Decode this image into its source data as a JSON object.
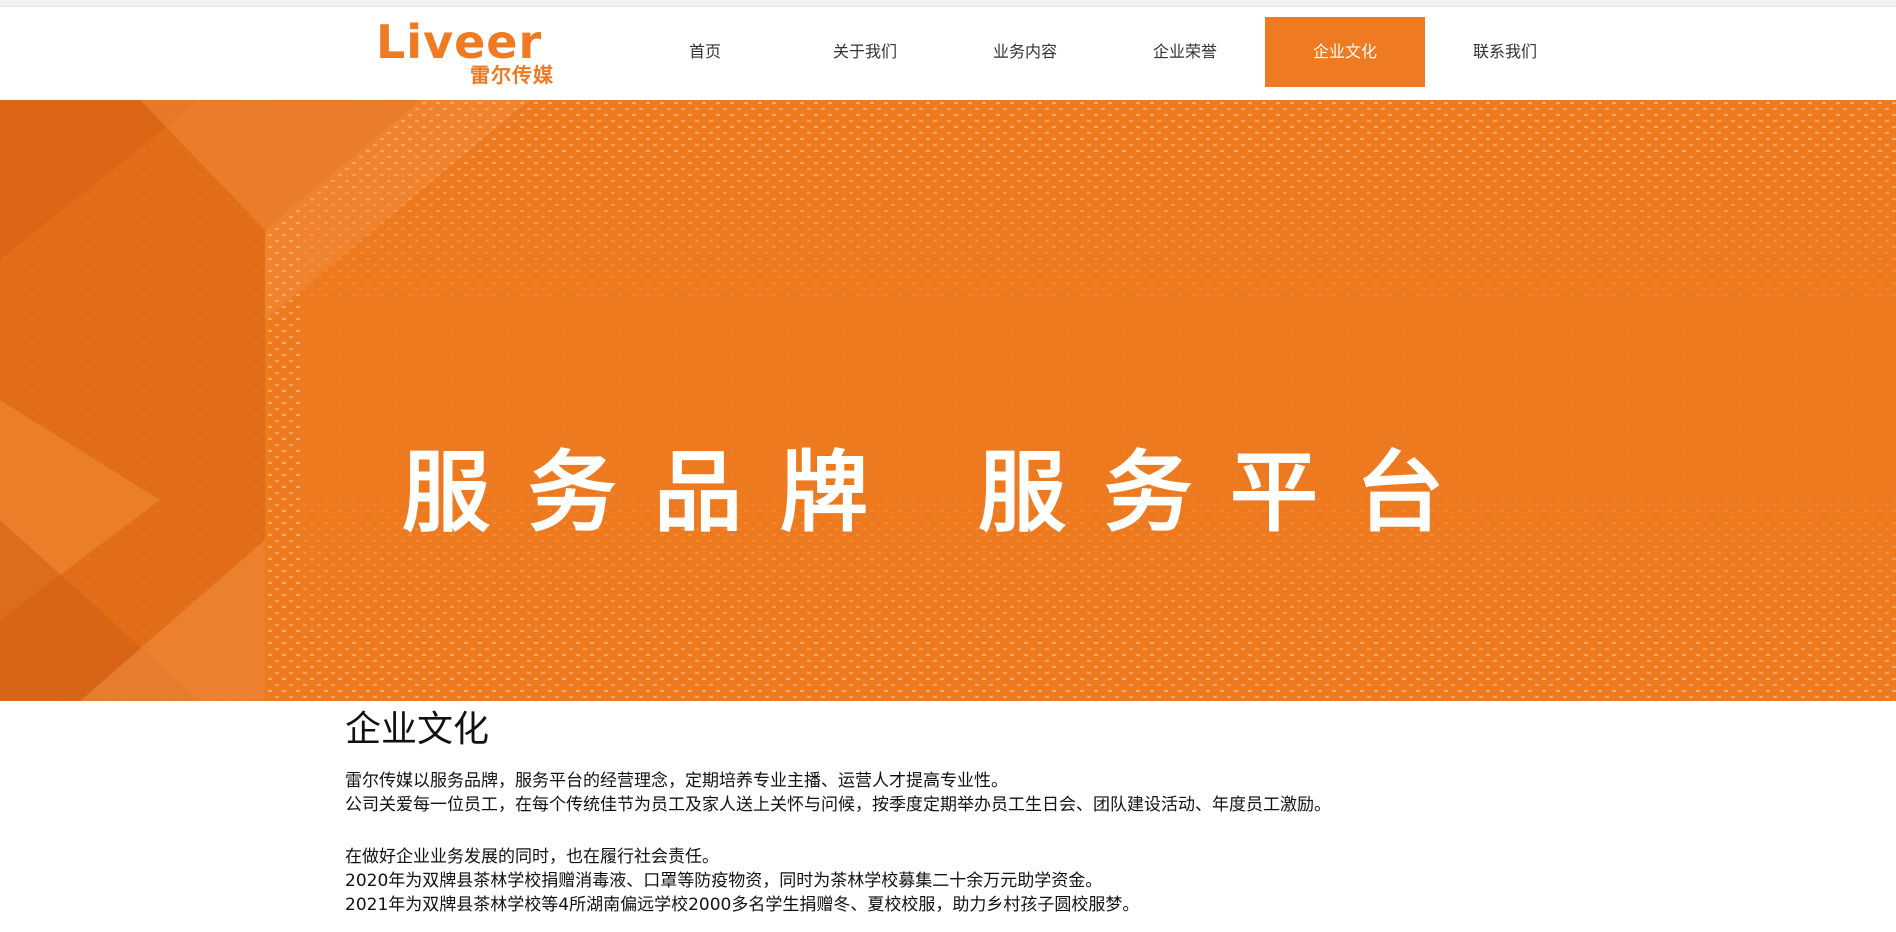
{
  "brand": {
    "logo_en": "Liveer",
    "logo_cn": "雷尔传媒",
    "accent_color": "#ee7a22"
  },
  "nav": {
    "items": [
      {
        "label": "首页",
        "active": false
      },
      {
        "label": "关于我们",
        "active": false
      },
      {
        "label": "业务内容",
        "active": false
      },
      {
        "label": "企业荣誉",
        "active": false
      },
      {
        "label": "企业文化",
        "active": true
      },
      {
        "label": "联系我们",
        "active": false
      }
    ]
  },
  "banner": {
    "slogan_left": "服务品牌",
    "slogan_right": "服务平台"
  },
  "content": {
    "title": "企业文化",
    "paragraphs": [
      "雷尔传媒以服务品牌，服务平台的经营理念，定期培养专业主播、运营人才提高专业性。",
      "公司关爱每一位员工，在每个传统佳节为员工及家人送上关怀与问候，按季度定期举办员工生日会、团队建设活动、年度员工激励。",
      "在做好企业业务发展的同时，也在履行社会责任。",
      "2020年为双牌县茶林学校捐赠消毒液、口罩等防疫物资，同时为茶林学校募集二十余万元助学资金。",
      "2021年为双牌县茶林学校等4所湖南偏远学校2000多名学生捐赠冬、夏校校服，助力乡村孩子圆校服梦。"
    ]
  }
}
